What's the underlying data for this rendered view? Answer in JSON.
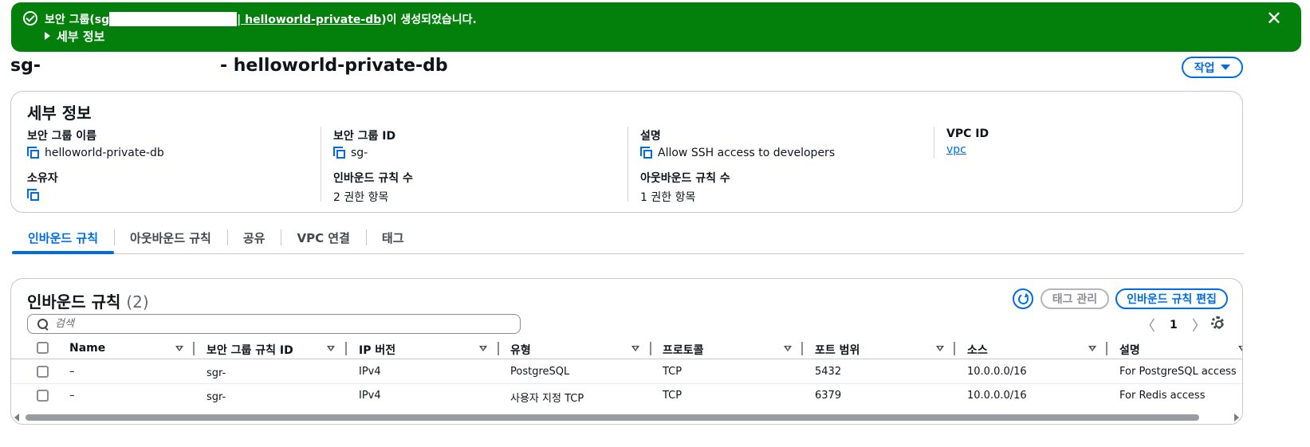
{
  "banner": {
    "message_prefix": "보안 그룹(sg",
    "message_link": "| helloworld-private-db",
    "message_suffix": ")이 생성되었습니다.",
    "details_label": "세부 정보",
    "close_glyph": "✕"
  },
  "page": {
    "title_prefix": "sg-",
    "title_suffix": "- helloworld-private-db",
    "actions_label": "작업"
  },
  "details": {
    "heading": "세부 정보",
    "fields": [
      {
        "label": "보안 그룹 이름",
        "value": "helloworld-private-db"
      },
      {
        "label": "보안 그룹 ID",
        "value": "sg-"
      },
      {
        "label": "설명",
        "value": "Allow SSH access to developers"
      },
      {
        "label": "VPC ID",
        "value": "vpc"
      },
      {
        "label": "소유자",
        "value": ""
      },
      {
        "label": "인바운드 규칙 수",
        "value": "2 권한 항목"
      },
      {
        "label": "아웃바운드 규칙 수",
        "value": "1 권한 항목"
      }
    ]
  },
  "tabs": [
    {
      "label": "인바운드 규칙",
      "active": true
    },
    {
      "label": "아웃바운드 규칙",
      "active": false
    },
    {
      "label": "공유",
      "active": false
    },
    {
      "label": "VPC 연결",
      "active": false
    },
    {
      "label": "태그",
      "active": false
    }
  ],
  "rules": {
    "heading": "인바운드 규칙",
    "count": "(2)",
    "manage_tags_label": "태그 관리",
    "edit_rules_label": "인바운드 규칙 편집",
    "search_placeholder": "검색",
    "page_number": "1",
    "columns": [
      "Name",
      "보안 그룹 규칙 ID",
      "IP 버전",
      "유형",
      "프로토콜",
      "포트 범위",
      "소스",
      "설명"
    ],
    "rows": [
      {
        "name": "–",
        "rule_id": "sgr-",
        "ip_version": "IPv4",
        "type": "PostgreSQL",
        "protocol": "TCP",
        "port_range": "5432",
        "source": "10.0.0.0/16",
        "description": "For PostgreSQL access"
      },
      {
        "name": "–",
        "rule_id": "sgr-",
        "ip_version": "IPv4",
        "type": "사용자 지정 TCP",
        "protocol": "TCP",
        "port_range": "6379",
        "source": "10.0.0.0/16",
        "description": "For Redis access"
      }
    ]
  },
  "colors": {
    "success_green": "#037f0c",
    "link_blue": "#006ce0",
    "border_gray": "#c6c6cd"
  },
  "icons": [
    "success-check-icon",
    "close-icon",
    "caret-right-icon",
    "caret-down-icon",
    "copy-icon",
    "refresh-icon",
    "search-icon",
    "chevron-left-icon",
    "chevron-right-icon",
    "gear-icon",
    "sort-icon"
  ]
}
